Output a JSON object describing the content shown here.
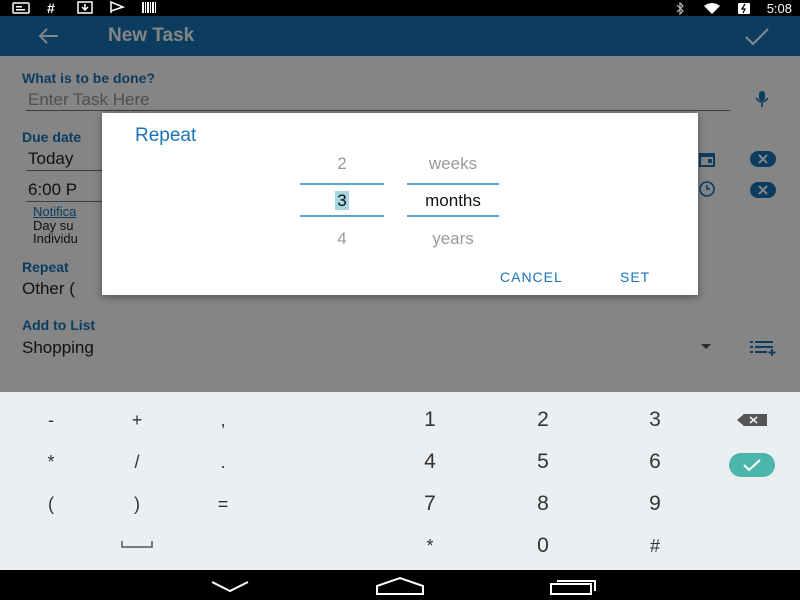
{
  "status_bar": {
    "left_icons": [
      "notification-icon",
      "hash-icon",
      "download-icon",
      "flag-icon",
      "barcode-icon"
    ],
    "right_icons": [
      "bluetooth-icon",
      "wifi-icon",
      "battery-icon"
    ],
    "time": "5:08"
  },
  "app_bar": {
    "title": "New Task",
    "back_icon": "arrow-left-icon",
    "confirm_icon": "check-icon"
  },
  "form": {
    "task_label": "What is to be done?",
    "task_placeholder": "Enter Task Here",
    "due_date_label": "Due date",
    "due_date_value": "Today",
    "due_time_value": "6:00 P",
    "notification_link": "Notifica",
    "day_summary_text": "Day su",
    "individual_text": "Individu",
    "repeat_label": "Repeat",
    "repeat_value": "Other (",
    "list_label": "Add to List",
    "list_value": "Shopping"
  },
  "dialog": {
    "title": "Repeat",
    "number_picker": {
      "above": "2",
      "selected": "3",
      "below": "4"
    },
    "unit_picker": {
      "above": "weeks",
      "selected": "months",
      "below": "years"
    },
    "cancel_label": "CANCEL",
    "set_label": "SET"
  },
  "keypad": {
    "rows": [
      [
        "-",
        "+",
        ",",
        "1",
        "2",
        "3"
      ],
      [
        "*",
        "/",
        ".",
        "4",
        "5",
        "6"
      ],
      [
        "(",
        ")",
        "=",
        "7",
        "8",
        "9"
      ],
      [
        "",
        "",
        "",
        "*",
        "0",
        "#"
      ]
    ]
  },
  "nav_bar": {
    "buttons": [
      "back-nav-icon",
      "home-nav-icon",
      "recents-nav-icon"
    ]
  },
  "colors": {
    "primary": "#1774b8",
    "accent_teal": "#4db6ac",
    "dim_overlay": "rgba(0,0,0,0.48)"
  }
}
